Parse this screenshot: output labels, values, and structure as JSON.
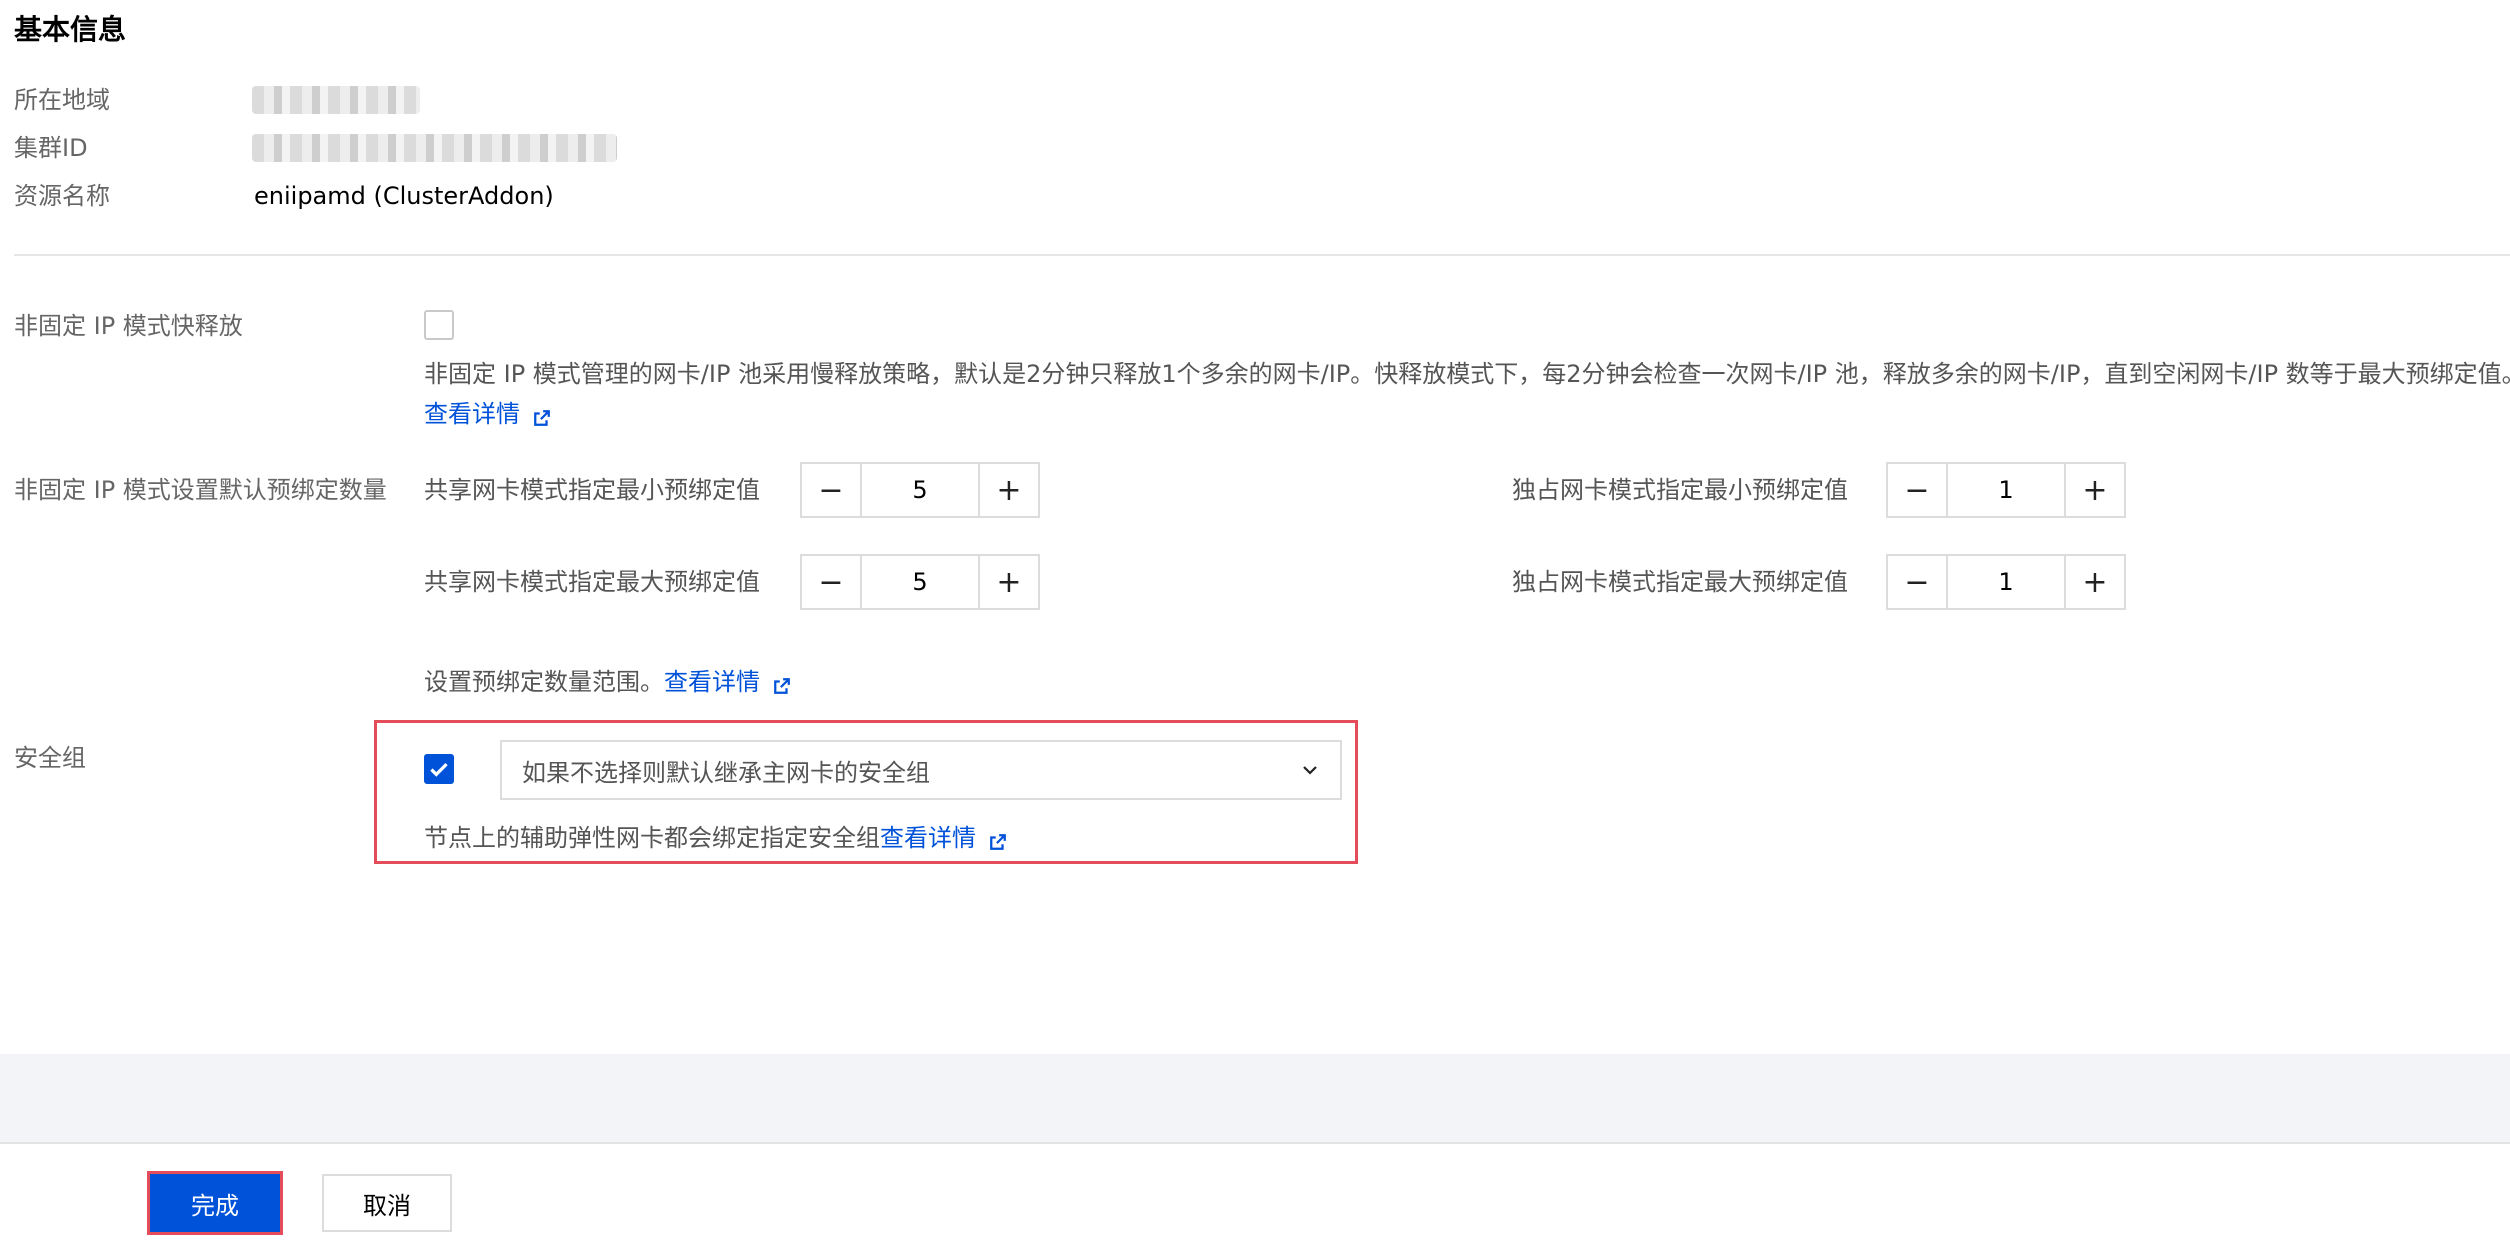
{
  "basic_info": {
    "title": "基本信息",
    "region_label": "所在地域",
    "cluster_id_label": "集群ID",
    "resource_name_label": "资源名称",
    "resource_name_value": "eniipamd (ClusterAddon)"
  },
  "fast_release": {
    "label": "非固定 IP 模式快释放",
    "checked": false,
    "description": "非固定 IP 模式管理的网卡/IP 池采用慢释放策略，默认是2分钟只释放1个多余的网卡/IP。快释放模式下，每2分钟会检查一次网卡/IP 池，释放多余的网卡/IP，直到空闲网卡/IP 数等于最大预绑定值。",
    "link_text": "查看详情"
  },
  "prebind": {
    "label": "非固定 IP 模式设置默认预绑定数量",
    "shared_min_label": "共享网卡模式指定最小预绑定值",
    "shared_min_value": "5",
    "shared_max_label": "共享网卡模式指定最大预绑定值",
    "shared_max_value": "5",
    "exclusive_min_label": "独占网卡模式指定最小预绑定值",
    "exclusive_min_value": "1",
    "exclusive_max_label": "独占网卡模式指定最大预绑定值",
    "exclusive_max_value": "1",
    "minus_symbol": "−",
    "plus_symbol": "+",
    "range_text": "设置预绑定数量范围。",
    "link_text": "查看详情"
  },
  "security_group": {
    "label": "安全组",
    "checked": true,
    "select_placeholder": "如果不选择则默认继承主网卡的安全组",
    "hint": "节点上的辅助弹性网卡都会绑定指定安全组",
    "link_text": "查看详情"
  },
  "footer": {
    "confirm_label": "完成",
    "cancel_label": "取消"
  },
  "colors": {
    "primary": "#0052d9",
    "highlight_border": "#e34d59"
  },
  "icons": [
    "external-link-icon",
    "chevron-down-icon",
    "checkmark-icon"
  ]
}
